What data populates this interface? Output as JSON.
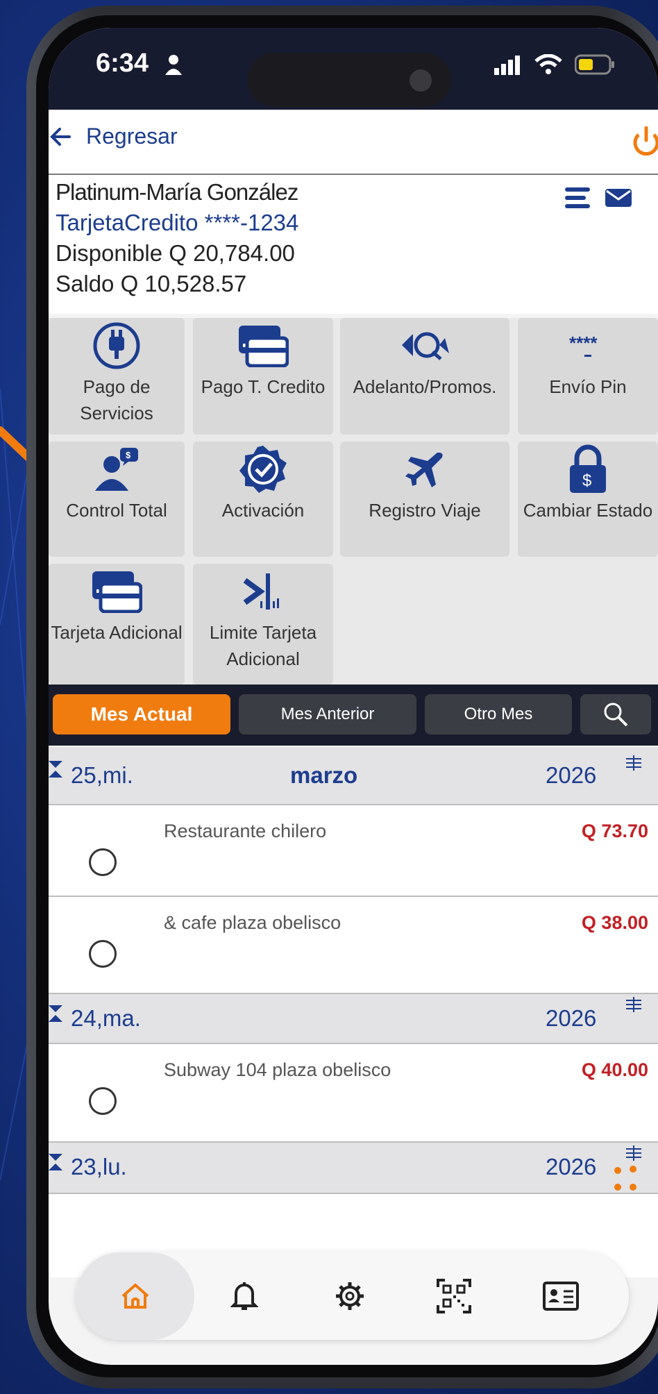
{
  "status_bar": {
    "time": "6:34"
  },
  "header": {
    "back_label": "Regresar"
  },
  "account": {
    "name": "Platinum-María González",
    "card_type": "TarjetaCredito",
    "card_mask": "****-1234",
    "available": "Disponible Q 20,784.00",
    "balance": "Saldo Q 10,528.57"
  },
  "actions": [
    {
      "label": "Pago de Servicios",
      "icon": "plug-icon"
    },
    {
      "label": "Pago T. Credito",
      "icon": "credit-card-icon"
    },
    {
      "label": "Adelanto/Promos.",
      "icon": "cash-advance-icon"
    },
    {
      "label": "Envío Pin",
      "icon": "pin-icon"
    },
    {
      "label": "Control Total",
      "icon": "user-control-icon"
    },
    {
      "label": "Activación",
      "icon": "verified-badge-icon"
    },
    {
      "label": "Registro Viaje",
      "icon": "airplane-icon"
    },
    {
      "label": "Cambiar Estado",
      "icon": "lock-icon"
    },
    {
      "label": "Tarjeta Adicional",
      "icon": "cards-icon"
    },
    {
      "label": "Limite Tarjeta Adicional",
      "icon": "limit-icon"
    }
  ],
  "tabs": {
    "current": "Mes Actual",
    "previous": "Mes Anterior",
    "other": "Otro Mes"
  },
  "transactions": {
    "day1": {
      "day": "25,mi.",
      "month": "marzo",
      "year": "2026"
    },
    "t1": {
      "desc": "Restaurante chilero",
      "amount": "Q 73.70"
    },
    "t2": {
      "desc": "& cafe plaza obelisco",
      "amount": "Q 38.00"
    },
    "day2": {
      "day": "24,ma.",
      "year": "2026"
    },
    "t3": {
      "desc": "Subway 104 plaza obelisco",
      "amount": "Q 40.00"
    },
    "day3": {
      "day": "23,lu.",
      "year": "2026"
    }
  },
  "colors": {
    "accent": "#f07c0f",
    "navy": "#1c3c8e",
    "amount_red": "#c21f24"
  }
}
